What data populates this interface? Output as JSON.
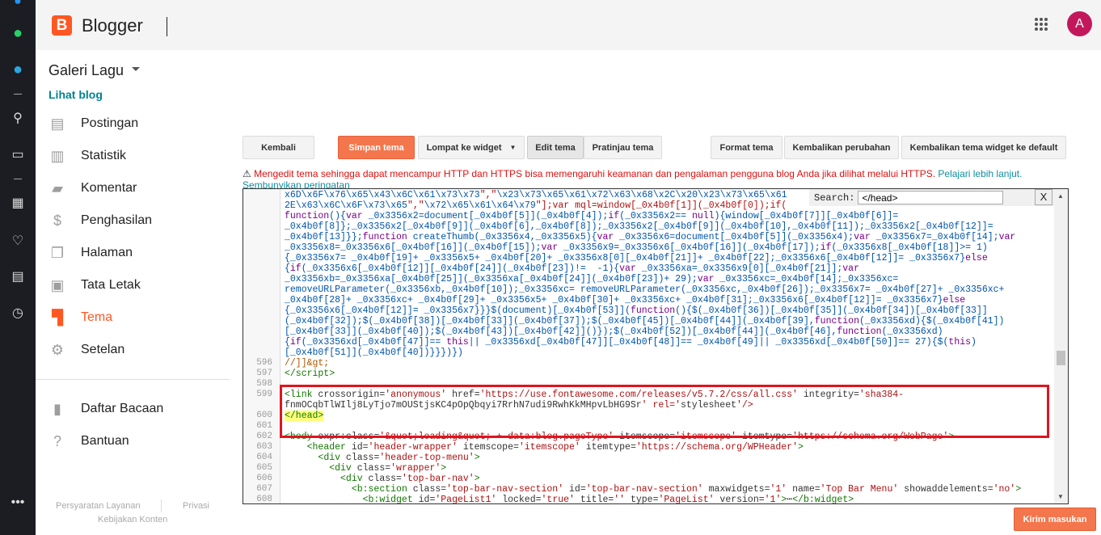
{
  "header": {
    "brand": "Blogger",
    "avatar_letter": "A"
  },
  "sidebar": {
    "blog_name": "Galeri Lagu",
    "view_blog": "Lihat blog",
    "items": [
      {
        "label": "Postingan",
        "icon": "posts-icon"
      },
      {
        "label": "Statistik",
        "icon": "stats-icon"
      },
      {
        "label": "Komentar",
        "icon": "comment-icon"
      },
      {
        "label": "Penghasilan",
        "icon": "dollar-icon"
      },
      {
        "label": "Halaman",
        "icon": "pages-icon"
      },
      {
        "label": "Tata Letak",
        "icon": "layout-icon"
      },
      {
        "label": "Tema",
        "icon": "theme-icon",
        "active": true
      },
      {
        "label": "Setelan",
        "icon": "gear-icon"
      }
    ],
    "secondary": [
      {
        "label": "Daftar Bacaan",
        "icon": "bookmark-icon"
      },
      {
        "label": "Bantuan",
        "icon": "help-icon"
      }
    ],
    "footer": {
      "terms": "Persyaratan Layanan",
      "privacy": "Privasi",
      "content_policy": "Kebijakan Konten"
    }
  },
  "toolbar": {
    "back": "Kembali",
    "save": "Simpan tema",
    "jump": "Lompat ke widget",
    "edit": "Edit tema",
    "preview": "Pratinjau tema",
    "format": "Format tema",
    "revert": "Kembalikan perubahan",
    "revert_default": "Kembalikan tema widget ke default"
  },
  "warning": {
    "text": "Mengedit tema sehingga dapat mencampur HTTP dan HTTPS bisa memengaruhi keamanan dan pengalaman pengguna blog Anda jika dilihat melalui HTTPS.",
    "learn_more": "Pelajari lebih lanjut.",
    "hide": "Sembunyikan peringatan"
  },
  "editor": {
    "search_label": "Search:",
    "search_value": "</head>",
    "close": "X",
    "lines": [
      {
        "n": "",
        "text": "x6D\\x6F\\x76\\x65\\x43\\x6C\\x61\\x73\\x73\",\"\\x23\\x73\\x65\\x61\\x72\\x63\\x68\\x2C\\x20\\x23\\x73\\x65\\x61"
      },
      {
        "n": "",
        "text": "2E\\x63\\x6C\\x6F\\x73\\x65\",\"\\x72\\x65\\x61\\x64\\x79\"];var mql=window[_0x4b0f[1]](_0x4b0f[0]);if("
      },
      {
        "n": "",
        "text": "function(){var _0x3356x2=document[_0x4b0f[5]](_0x4b0f[4]);if(_0x3356x2== null){window[_0x4b0f[7]][_0x4b0f[6]]="
      },
      {
        "n": "",
        "text": "_0x4b0f[8]};_0x3356x2[_0x4b0f[9]](_0x4b0f[6],_0x4b0f[8]);_0x3356x2[_0x4b0f[9]](_0x4b0f[10],_0x4b0f[11]);_0x3356x2[_0x4b0f[12]]="
      },
      {
        "n": "",
        "text": "_0x4b0f[13]}};function createThumb(_0x3356x4,_0x3356x5){var _0x3356x6=document[_0x4b0f[5]](_0x3356x4);var _0x3356x7=_0x4b0f[14];var"
      },
      {
        "n": "",
        "text": "_0x3356x8=_0x3356x6[_0x4b0f[16]](_0x4b0f[15]);var _0x3356x9=_0x3356x6[_0x4b0f[16]](_0x4b0f[17]);if(_0x3356x8[_0x4b0f[18]]>= 1)"
      },
      {
        "n": "",
        "text": "{_0x3356x7= _0x4b0f[19]+ _0x3356x5+ _0x4b0f[20]+ _0x3356x8[0][_0x4b0f[21]]+ _0x4b0f[22];_0x3356x6[_0x4b0f[12]]= _0x3356x7}else"
      },
      {
        "n": "",
        "text": "{if(_0x3356x6[_0x4b0f[12]][_0x4b0f[24]](_0x4b0f[23])!=  -1){var _0x3356xa=_0x3356x9[0][_0x4b0f[21]];var"
      },
      {
        "n": "",
        "text": "_0x3356xb=_0x3356xa[_0x4b0f[25]](_0x3356xa[_0x4b0f[24]](_0x4b0f[23])+ 29);var _0x3356xc=_0x4b0f[14];_0x3356xc="
      },
      {
        "n": "",
        "text": "removeURLParameter(_0x3356xb,_0x4b0f[10]);_0x3356xc= removeURLParameter(_0x3356xc,_0x4b0f[26]);_0x3356x7= _0x4b0f[27]+ _0x3356xc+"
      },
      {
        "n": "",
        "text": "_0x4b0f[28]+ _0x3356xc+ _0x4b0f[29]+ _0x3356x5+ _0x4b0f[30]+ _0x3356xc+ _0x4b0f[31];_0x3356x6[_0x4b0f[12]]= _0x3356x7}else"
      },
      {
        "n": "",
        "text": "{_0x3356x6[_0x4b0f[12]]= _0x3356x7}}}$(document)[_0x4b0f[53]](function(){$(_0x4b0f[36])[_0x4b0f[35]](_0x4b0f[34])[_0x4b0f[33]]"
      },
      {
        "n": "",
        "text": "(_0x4b0f[32]);$(_0x4b0f[38])[_0x4b0f[33]](_0x4b0f[37]);$(_0x4b0f[45])[_0x4b0f[44]](_0x4b0f[39],function(_0x3356xd){$(_0x4b0f[41])"
      },
      {
        "n": "",
        "text": "[_0x4b0f[33]](_0x4b0f[40]);$(_0x4b0f[43])[_0x4b0f[42]]()});$(_0x4b0f[52])[_0x4b0f[44]](_0x4b0f[46],function(_0x3356xd)"
      },
      {
        "n": "",
        "text": "{if(_0x3356xd[_0x4b0f[47]]== this|| _0x3356xd[_0x4b0f[47]][_0x4b0f[48]]== _0x4b0f[49]|| _0x3356xd[_0x4b0f[50]]== 27){$(this)"
      },
      {
        "n": "",
        "text": "[_0x4b0f[51]](_0x4b0f[40])}}})})"
      },
      {
        "n": "596",
        "text": "//]]&gt;"
      },
      {
        "n": "597",
        "text": "</script>"
      },
      {
        "n": "598",
        "text": ""
      },
      {
        "n": "599",
        "text": "<link crossorigin='anonymous' href='https://use.fontawesome.com/releases/v5.7.2/css/all.css' integrity='sha384-"
      },
      {
        "n": "",
        "text": "fnmOCqbTlWIlj8LyTjo7mOUStjsKC4pOpQbqyi7RrhN7udi9RwhKkMHpvLbHG9Sr' rel='stylesheet'/>"
      },
      {
        "n": "600",
        "text": "</head>",
        "match": true
      },
      {
        "n": "601",
        "text": ""
      },
      {
        "n": "602",
        "text": "<body expr:class='&quot;loading&quot; + data:blog.pageType' itemscope='itemscope' itemtype='https://schema.org/WebPage'>"
      },
      {
        "n": "603",
        "text": "    <header id='header-wrapper' itemscope='itemscope' itemtype='https://schema.org/WPHeader'>"
      },
      {
        "n": "604",
        "text": "      <div class='header-top-menu'>"
      },
      {
        "n": "605",
        "text": "        <div class='wrapper'>"
      },
      {
        "n": "606",
        "text": "          <div class='top-bar-nav'>"
      },
      {
        "n": "607",
        "text": "            <b:section class='top-bar-nav-section' id='top-bar-nav-section' maxwidgets='1' name='Top Bar Menu' showaddelements='no'>"
      },
      {
        "n": "608",
        "text": "              <b:widget id='PageList1' locked='true' title='' type='PageList' version='1'>⋯</b:widget>"
      }
    ]
  },
  "feedback": "Kirim masukan",
  "colors": {
    "accent": "#ff5722",
    "button_orange": "#f4764c",
    "link": "#00838f",
    "warning": "#dd1111",
    "highlight_box": "#e0141e"
  }
}
